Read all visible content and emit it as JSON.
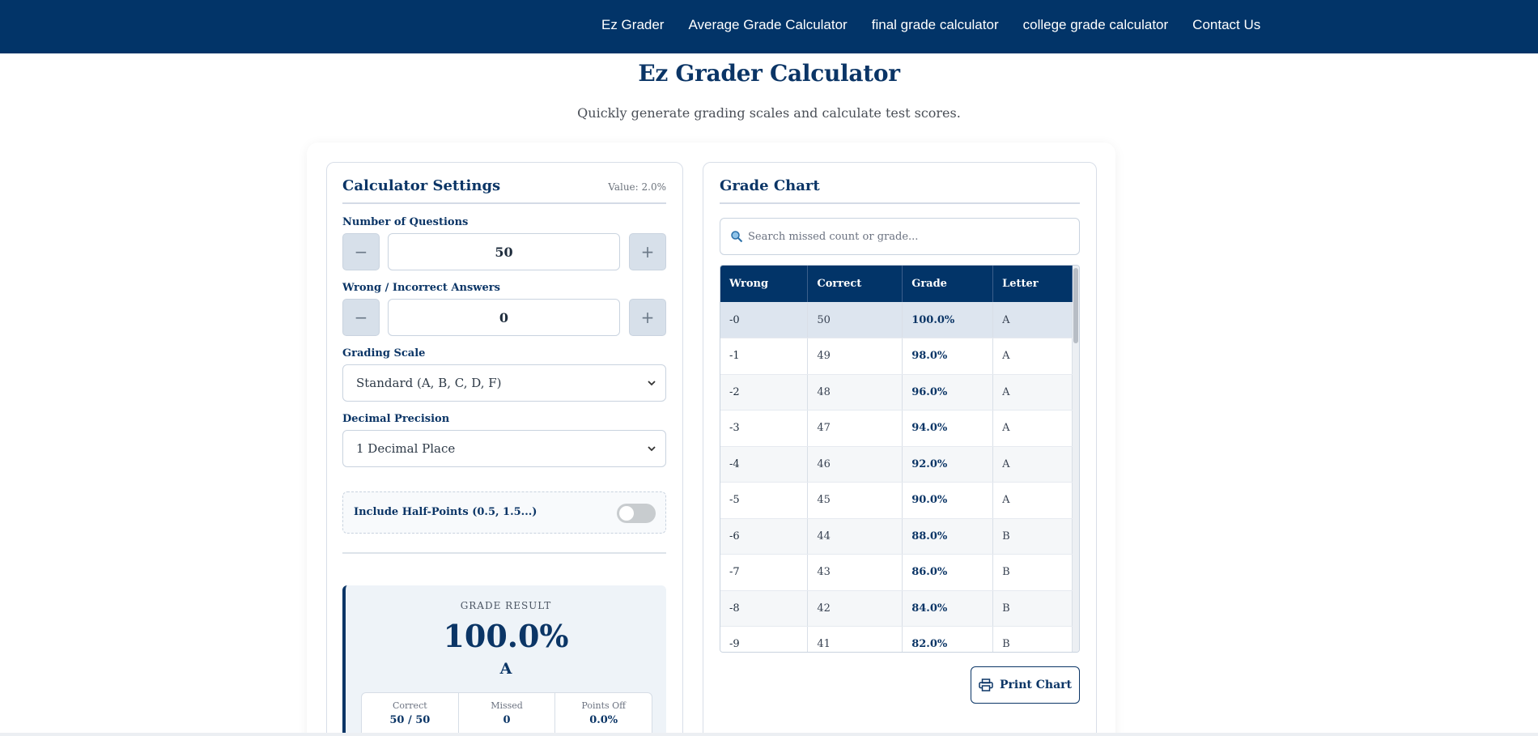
{
  "nav": {
    "items": [
      {
        "label": "Ez Grader"
      },
      {
        "label": "Average Grade Calculator"
      },
      {
        "label": "final grade calculator"
      },
      {
        "label": "college grade calculator"
      },
      {
        "label": "Contact Us"
      }
    ]
  },
  "header": {
    "title": "Ez Grader Calculator",
    "subtitle": "Quickly generate grading scales and calculate test scores."
  },
  "settings": {
    "title": "Calculator Settings",
    "value_tag": "Value: 2.0%",
    "questions": {
      "label": "Number of Questions",
      "value": "50",
      "minus": "−",
      "plus": "+"
    },
    "wrong": {
      "label": "Wrong / Incorrect Answers",
      "value": "0",
      "minus": "−",
      "plus": "+"
    },
    "scale": {
      "label": "Grading Scale",
      "selected": "Standard (A, B, C, D, F)"
    },
    "precision": {
      "label": "Decimal Precision",
      "selected": "1 Decimal Place"
    },
    "half_points": {
      "label": "Include Half-Points (0.5, 1.5...)",
      "enabled": false
    }
  },
  "result": {
    "label": "GRADE RESULT",
    "value": "100.0%",
    "letter": "A",
    "stats": [
      {
        "key": "Correct",
        "value": "50 / 50"
      },
      {
        "key": "Missed",
        "value": "0"
      },
      {
        "key": "Points Off",
        "value": "0.0%"
      }
    ]
  },
  "chart": {
    "title": "Grade Chart",
    "search_placeholder": "Search missed count or grade...",
    "columns": [
      "Wrong",
      "Correct",
      "Grade",
      "Letter"
    ],
    "rows": [
      {
        "wrong": "-0",
        "correct": "50",
        "grade": "100.0%",
        "letter": "A"
      },
      {
        "wrong": "-1",
        "correct": "49",
        "grade": "98.0%",
        "letter": "A"
      },
      {
        "wrong": "-2",
        "correct": "48",
        "grade": "96.0%",
        "letter": "A"
      },
      {
        "wrong": "-3",
        "correct": "47",
        "grade": "94.0%",
        "letter": "A"
      },
      {
        "wrong": "-4",
        "correct": "46",
        "grade": "92.0%",
        "letter": "A"
      },
      {
        "wrong": "-5",
        "correct": "45",
        "grade": "90.0%",
        "letter": "A"
      },
      {
        "wrong": "-6",
        "correct": "44",
        "grade": "88.0%",
        "letter": "B"
      },
      {
        "wrong": "-7",
        "correct": "43",
        "grade": "86.0%",
        "letter": "B"
      },
      {
        "wrong": "-8",
        "correct": "42",
        "grade": "84.0%",
        "letter": "B"
      },
      {
        "wrong": "-9",
        "correct": "41",
        "grade": "82.0%",
        "letter": "B"
      }
    ],
    "print_label": "Print Chart"
  },
  "colors": {
    "brand": "#023468",
    "accent": "#0b3566"
  },
  "icons": {
    "search": "search-icon",
    "print": "printer-icon",
    "chevron": "chevron-down-icon"
  }
}
